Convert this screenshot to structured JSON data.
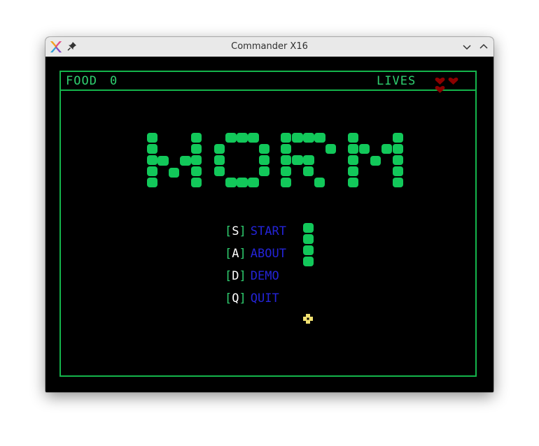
{
  "window": {
    "title": "Commander X16",
    "app_icon": "x16-logo-icon",
    "pin_icon": "pin-icon",
    "minimize_icon": "chevron-down-icon",
    "maximize_icon": "chevron-up-icon"
  },
  "hud": {
    "food_label": "FOOD",
    "food_value": "0",
    "lives_label": "LIVES",
    "lives": 3,
    "heart_icon": "heart-icon",
    "heart_color": "#8b0000"
  },
  "game": {
    "logo_text": "WORM",
    "menu": [
      {
        "open": "[",
        "key": "S",
        "close": "]",
        "label": "START"
      },
      {
        "open": "[",
        "key": "A",
        "close": "]",
        "label": "ABOUT"
      },
      {
        "open": "[",
        "key": "D",
        "close": "]",
        "label": "DEMO"
      },
      {
        "open": "[",
        "key": "Q",
        "close": "]",
        "label": "QUIT"
      }
    ],
    "food_icon": "flower-food-icon"
  },
  "colors": {
    "screen_bg": "#000000",
    "worm_green": "#12c85a",
    "border_green": "#14b44b",
    "hud_text": "#2fd070",
    "menu_label": "#2424d8",
    "menu_key": "#ffffff",
    "food": "#f0e070"
  }
}
